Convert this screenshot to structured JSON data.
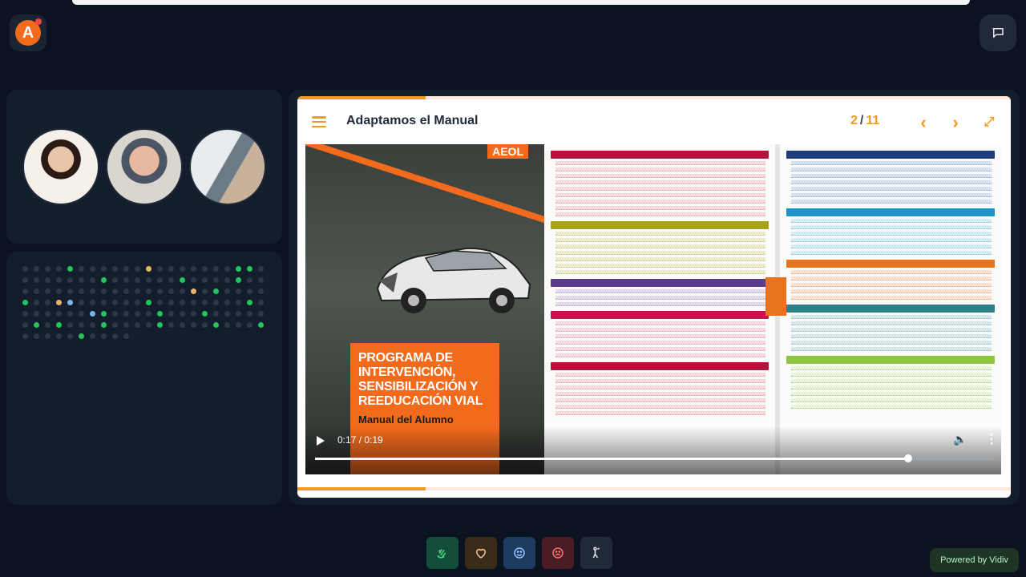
{
  "viewer": {
    "title": "Adaptamos el Manual",
    "page_current": "2",
    "page_separator": "/",
    "page_total": "11",
    "progress_fraction": 0.18
  },
  "book": {
    "publisher_badge": "AEOL",
    "cover_title": "PROGRAMA DE INTERVENCIÓN, SENSIBILIZACIÓN Y REEDUCACIÓN VIAL",
    "cover_subtitle": "Manual del Alumno"
  },
  "video": {
    "time_display": "0:17 / 0:19",
    "played_fraction": 0.87
  },
  "participants": [
    {
      "name": "participant-1"
    },
    {
      "name": "participant-2"
    },
    {
      "name": "participant-3"
    }
  ],
  "reactions": [
    {
      "icon": "clap-icon"
    },
    {
      "icon": "heart-icon"
    },
    {
      "icon": "smile-icon"
    },
    {
      "icon": "sad-icon"
    },
    {
      "icon": "raise-hand-icon"
    }
  ],
  "footer": {
    "powered_by": "Powered by Vidiv"
  },
  "colors": {
    "accent": "#f39a1e",
    "brand": "#f26b1d",
    "background": "#0b1220",
    "panel": "#141d2c"
  }
}
